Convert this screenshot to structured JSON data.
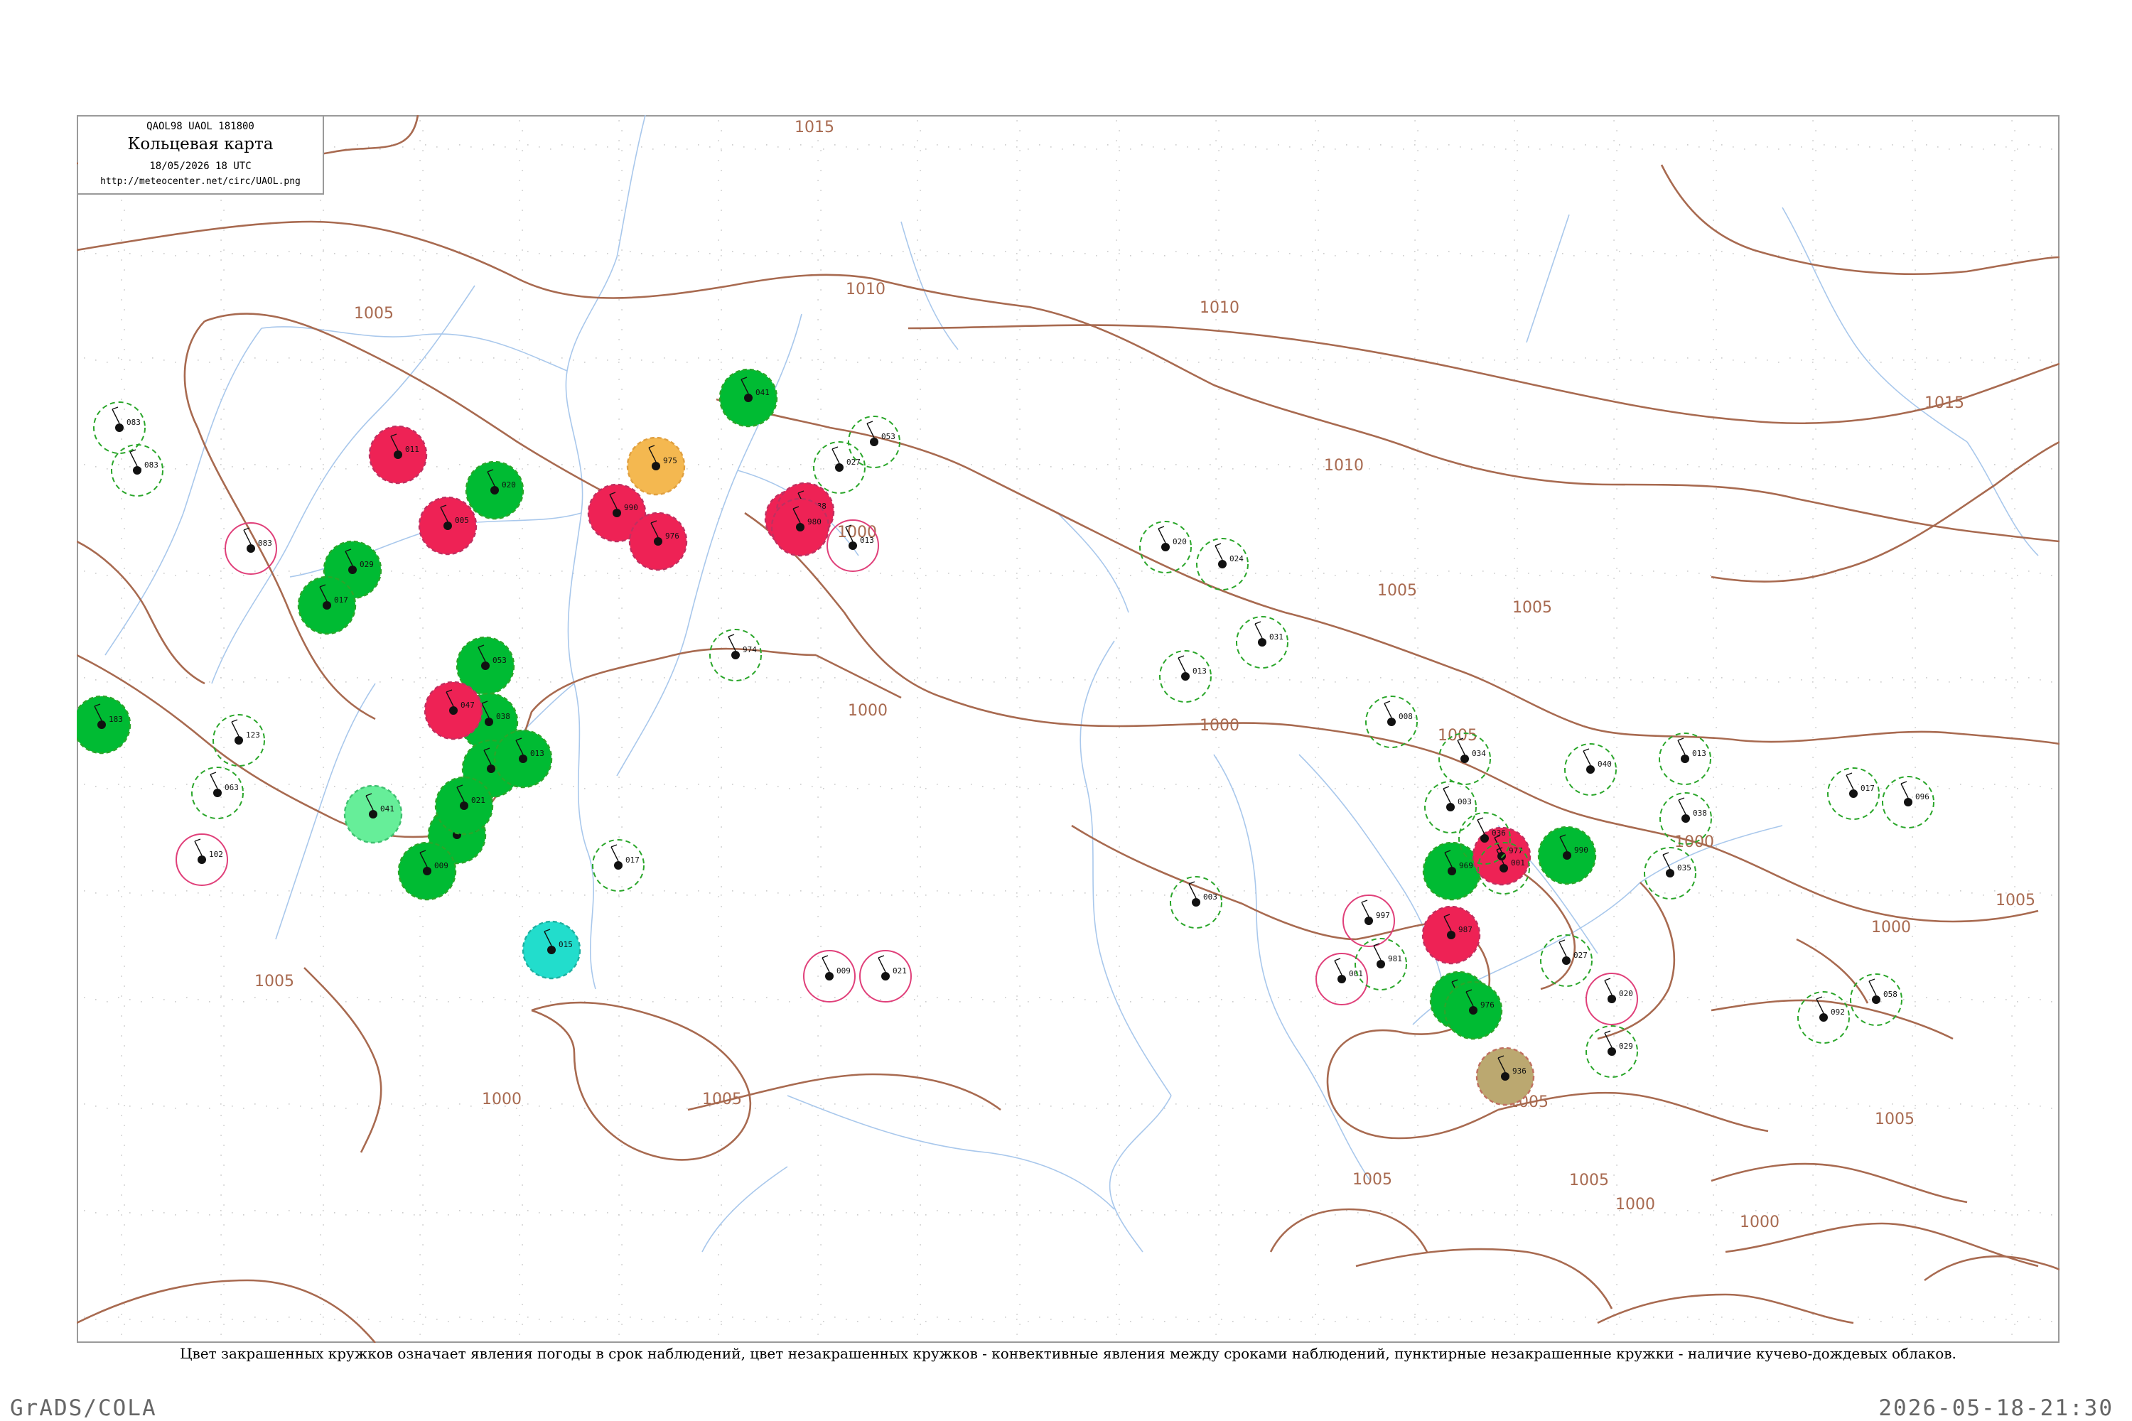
{
  "title_box": {
    "header": "QAOL98  UAOL  181800",
    "title": "Кольцевая карта",
    "time": "18/05/2026 18 UTC",
    "url": "http://meteocenter.net/circ/UAOL.png"
  },
  "footnote": "Цвет закрашенных кружков означает явления погоды в срок наблюдений, цвет незакрашенных кружков - конвективные явления между сроками наблюдений, пунктирные незакрашенные кружки - наличие кучево-дождевых облаков.",
  "software": "GrADS/COLA",
  "timestamp": "2026-05-18-21:30",
  "colors": {
    "isobar": "#a86a50",
    "river": "#a9c8ec",
    "thunder_fill": "#00bb33",
    "thunder_ring": "#2aa62a",
    "rain_fill": "#ee2255",
    "shower_ring": "#e0407a",
    "fog_fill": "#f4b850",
    "haze_fill": "#66ee99",
    "drizzle_fill": "#22ddcc",
    "dust_fill": "#bba870"
  },
  "isobar_labels": [
    "1015",
    "1010",
    "1005",
    "1010",
    "1010",
    "1005",
    "1010",
    "1015",
    "1005",
    "1000",
    "1000",
    "1005",
    "1005",
    "1000",
    "1000",
    "1000",
    "1005",
    "1000",
    "1005",
    "1005",
    "1000",
    "1005",
    "1005",
    "1005",
    "1000",
    "1005"
  ],
  "stations": [
    {
      "kind": "thunder",
      "pressure": "183"
    },
    {
      "kind": "rain",
      "pressure": "011"
    },
    {
      "kind": "thunder",
      "pressure": "020"
    },
    {
      "kind": "rain",
      "pressure": "005"
    },
    {
      "kind": "thunder",
      "pressure": "029"
    },
    {
      "kind": "thunder",
      "pressure": "017"
    },
    {
      "kind": "thunder",
      "pressure": "053"
    },
    {
      "kind": "rain",
      "pressure": "990"
    },
    {
      "kind": "rain",
      "pressure": "976"
    },
    {
      "kind": "fog",
      "pressure": "975"
    },
    {
      "kind": "rain",
      "pressure": "983"
    },
    {
      "kind": "rain",
      "pressure": "988"
    },
    {
      "kind": "thunder",
      "pressure": "041"
    },
    {
      "kind": "rain",
      "pressure": "980"
    },
    {
      "kind": "thunder",
      "pressure": "038"
    },
    {
      "kind": "rain",
      "pressure": "047"
    },
    {
      "kind": "thunder",
      "pressure": "016"
    },
    {
      "kind": "thunder",
      "pressure": "027"
    },
    {
      "kind": "thunder",
      "pressure": "021"
    },
    {
      "kind": "thunder",
      "pressure": "013"
    },
    {
      "kind": "haze",
      "pressure": "041"
    },
    {
      "kind": "drizzle",
      "pressure": "015"
    },
    {
      "kind": "thunder",
      "pressure": "009"
    },
    {
      "kind": "thunder",
      "pressure": "984"
    },
    {
      "kind": "rain",
      "pressure": "987"
    },
    {
      "kind": "thunder",
      "pressure": "969"
    },
    {
      "kind": "rain",
      "pressure": "977"
    },
    {
      "kind": "thunder",
      "pressure": "990"
    },
    {
      "kind": "thunder",
      "pressure": "976"
    },
    {
      "kind": "dust",
      "pressure": "936"
    },
    {
      "kind": "cb",
      "pressure": "083"
    },
    {
      "kind": "cb",
      "pressure": "083"
    },
    {
      "kind": "shower",
      "pressure": "083"
    },
    {
      "kind": "cb",
      "pressure": "123"
    },
    {
      "kind": "cb",
      "pressure": "063"
    },
    {
      "kind": "shower",
      "pressure": "102"
    },
    {
      "kind": "cb",
      "pressure": "017"
    },
    {
      "kind": "cb",
      "pressure": "027"
    },
    {
      "kind": "cb",
      "pressure": "053"
    },
    {
      "kind": "shower",
      "pressure": "013"
    },
    {
      "kind": "cb",
      "pressure": "974"
    },
    {
      "kind": "cb",
      "pressure": "020"
    },
    {
      "kind": "cb",
      "pressure": "024"
    },
    {
      "kind": "cb",
      "pressure": "008"
    },
    {
      "kind": "cb",
      "pressure": "013"
    },
    {
      "kind": "cb",
      "pressure": "003"
    },
    {
      "kind": "shower",
      "pressure": "009"
    },
    {
      "kind": "cb",
      "pressure": "031"
    },
    {
      "kind": "shower",
      "pressure": "997"
    },
    {
      "kind": "shower",
      "pressure": "001"
    },
    {
      "kind": "cb",
      "pressure": "981"
    },
    {
      "kind": "cb",
      "pressure": "034"
    },
    {
      "kind": "cb",
      "pressure": "003"
    },
    {
      "kind": "cb",
      "pressure": "036"
    },
    {
      "kind": "cb",
      "pressure": "001"
    },
    {
      "kind": "cb",
      "pressure": "027"
    },
    {
      "kind": "cb",
      "pressure": "029"
    },
    {
      "kind": "shower",
      "pressure": "020"
    },
    {
      "kind": "cb",
      "pressure": "013"
    },
    {
      "kind": "cb",
      "pressure": "035"
    },
    {
      "kind": "cb",
      "pressure": "038"
    },
    {
      "kind": "cb",
      "pressure": "040"
    },
    {
      "kind": "cb",
      "pressure": "017"
    },
    {
      "kind": "cb",
      "pressure": "096"
    },
    {
      "kind": "cb",
      "pressure": "058"
    },
    {
      "kind": "cb",
      "pressure": "092"
    },
    {
      "kind": "shower",
      "pressure": "021"
    }
  ]
}
